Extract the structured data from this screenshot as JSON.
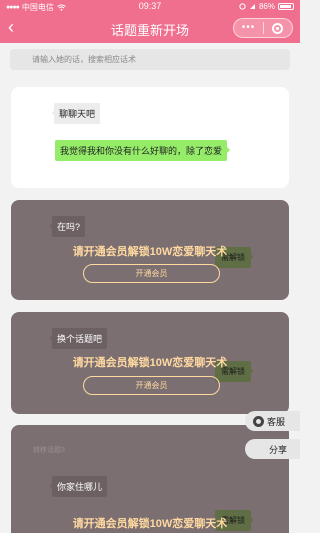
{
  "status": {
    "carrier": "中国电信",
    "time": "09:37",
    "battery": "86%"
  },
  "nav": {
    "back_glyph": "‹",
    "title": "话题重新开场",
    "more_glyph": "•••"
  },
  "search": {
    "placeholder": "请输入她的话，搜索相应话术"
  },
  "card1": {
    "her_message": "聊聊天吧",
    "reply": "我觉得我和你没有什么好聊的，除了恋爱"
  },
  "locked_cards": [
    {
      "question": "在吗?",
      "lock_label": "需解锁",
      "promo": "请开通会员解锁10W恋爱聊天术",
      "button": "开通会员"
    },
    {
      "question": "换个话题吧",
      "lock_label": "需解锁",
      "promo": "请开通会员解锁10W恋爱聊天术",
      "button": "开通会员"
    },
    {
      "tag": "转移话题3",
      "question": "你家住哪儿",
      "lock_label": "需解锁",
      "promo": "请开通会员解锁10W恋爱聊天术"
    }
  ],
  "floats": {
    "service": "客服",
    "share": "分享"
  },
  "colors": {
    "brand": "#f06f8e",
    "promo": "#ffd9a0",
    "locked_card": "#7b6f72",
    "reply_bubble": "#95ec69"
  }
}
